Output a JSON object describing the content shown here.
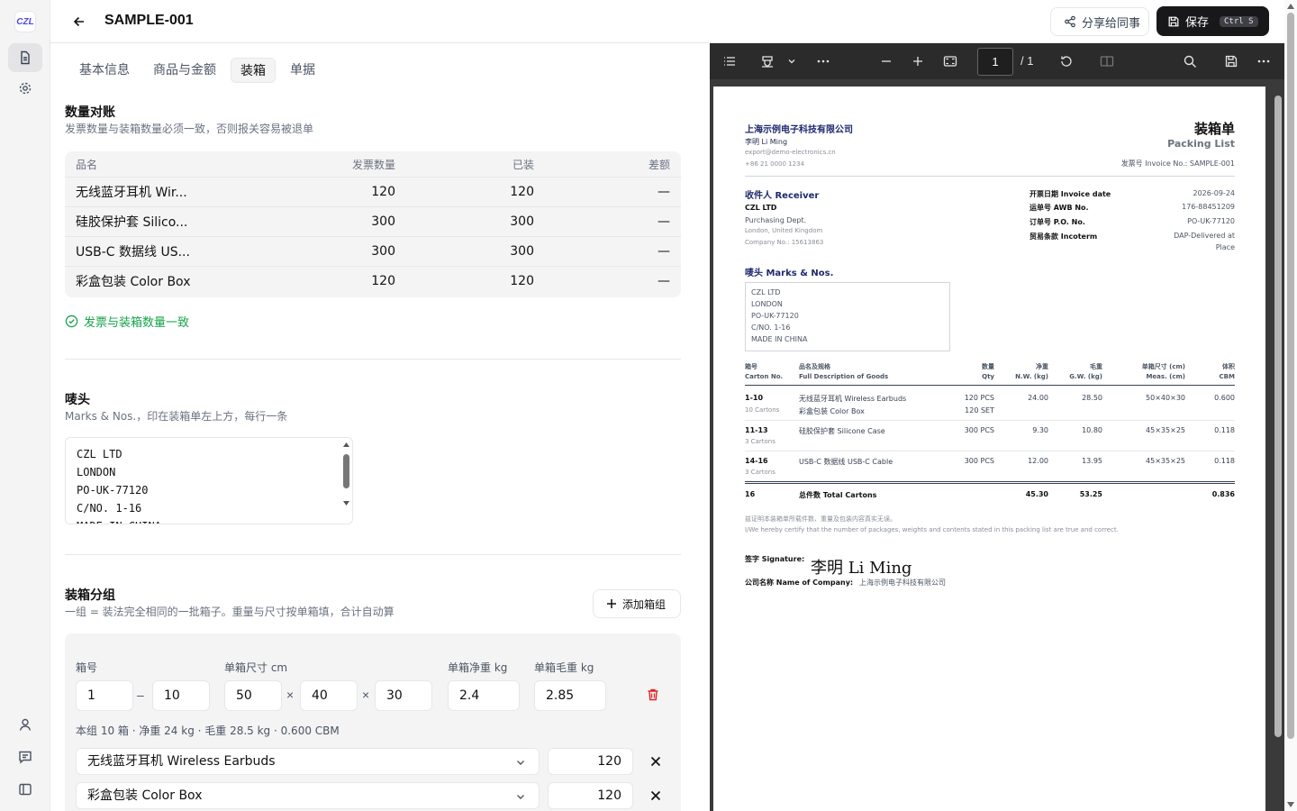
{
  "app": {
    "logo_text": "CZL"
  },
  "header": {
    "doc_title": "SAMPLE-001",
    "share_label": "分享给同事",
    "save_label": "保存",
    "save_shortcut": "Ctrl S"
  },
  "tabs": [
    {
      "label": "基本信息"
    },
    {
      "label": "商品与金额"
    },
    {
      "label": "装箱",
      "active": true
    },
    {
      "label": "单据"
    }
  ],
  "qty_check": {
    "title": "数量对账",
    "subtitle": "发票数量与装箱数量必须一致，否则报关容易被退单",
    "columns": [
      "品名",
      "发票数量",
      "已装",
      "差额"
    ],
    "rows": [
      {
        "name": "无线蓝牙耳机 Wir...",
        "invoice": "120",
        "packed": "120",
        "diff": "—"
      },
      {
        "name": "硅胶保护套 Silico...",
        "invoice": "300",
        "packed": "300",
        "diff": "—"
      },
      {
        "name": "USB-C 数据线 US...",
        "invoice": "300",
        "packed": "300",
        "diff": "—"
      },
      {
        "name": "彩盒包装 Color Box",
        "invoice": "120",
        "packed": "120",
        "diff": "—"
      }
    ],
    "status": "发票与装箱数量一致"
  },
  "marks": {
    "title": "唛头",
    "subtitle": "Marks & Nos.，印在装箱单左上方，每行一条",
    "lines": [
      "CZL LTD",
      "LONDON",
      "PO-UK-77120",
      "C/NO. 1-16",
      "MADE IN CHINA"
    ]
  },
  "packing_groups": {
    "title": "装箱分组",
    "subtitle": "一组 = 装法完全相同的一批箱子。重量与尺寸按单箱填，合计自动算",
    "add_label": "添加箱组",
    "labels": {
      "carton_no": "箱号",
      "dims": "单箱尺寸 cm",
      "net": "单箱净重 kg",
      "gross": "单箱毛重 kg"
    },
    "group": {
      "from": "1",
      "to": "10",
      "l": "50",
      "w": "40",
      "h": "30",
      "net": "2.4",
      "gross": "2.85",
      "summary": "本组 10 箱 · 净重 24 kg · 毛重 28.5 kg · 0.600 CBM",
      "items": [
        {
          "name": "无线蓝牙耳机 Wireless Earbuds",
          "qty": "120"
        },
        {
          "name": "彩盒包装 Color Box",
          "qty": "120"
        }
      ]
    },
    "dash": "–",
    "times": "×"
  },
  "pdf_toolbar": {
    "page": "1",
    "total": "/ 1"
  },
  "pdf": {
    "company": "上海示例电子科技有限公司",
    "contact": "李明 Li Ming",
    "email": "export@demo-electronics.cn",
    "phone": "+86 21 0000 1234",
    "doc_title_cn": "装箱单",
    "doc_title_en": "Packing List",
    "invoice_ref": "发票号 Invoice No.: SAMPLE-001",
    "receiver_title": "收件人 Receiver",
    "receiver_name": "CZL LTD",
    "receiver_dept": "Purchasing Dept.",
    "receiver_city": "London, United Kingdom",
    "receiver_company_no": "Company No.: 15613863",
    "meta": [
      {
        "label": "开票日期 Invoice date",
        "value": "2026-09-24"
      },
      {
        "label": "运单号 AWB No.",
        "value": "176-88451209"
      },
      {
        "label": "订单号 P.O. No.",
        "value": "PO-UK-77120"
      },
      {
        "label": "贸易条款 Incoterm",
        "value": "DAP-Delivered at",
        "value2": "Place"
      }
    ],
    "marks_title": "唛头 Marks & Nos.",
    "marks_lines": [
      "CZL LTD",
      "LONDON",
      "PO-UK-77120",
      "C/NO. 1-16",
      "MADE IN CHINA"
    ],
    "table_head": {
      "carton_cn": "箱号",
      "carton_en": "Carton No.",
      "desc_cn": "品名及规格",
      "desc_en": "Full Description of Goods",
      "qty_cn": "数量",
      "qty_en": "Qty",
      "nw_cn": "净重",
      "nw_en": "N.W. (kg)",
      "gw_cn": "毛重",
      "gw_en": "G.W. (kg)",
      "meas_cn": "单箱尺寸 (cm)",
      "meas_en": "Meas. (cm)",
      "cbm_cn": "体积",
      "cbm_en": "CBM"
    },
    "rows": [
      {
        "carton": "1-10",
        "cartons": "10 Cartons",
        "desc": "无线蓝牙耳机 Wireless Earbuds",
        "desc2": "彩盒包装 Color Box",
        "qty": "120 PCS",
        "qty2": "120 SET",
        "nw": "24.00",
        "gw": "28.50",
        "meas": "50×40×30",
        "cbm": "0.600"
      },
      {
        "carton": "11-13",
        "cartons": "3 Cartons",
        "desc": "硅胶保护套 Silicone Case",
        "qty": "300 PCS",
        "nw": "9.30",
        "gw": "10.80",
        "meas": "45×35×25",
        "cbm": "0.118"
      },
      {
        "carton": "14-16",
        "cartons": "3 Cartons",
        "desc": "USB-C 数据线 USB-C Cable",
        "qty": "300 PCS",
        "nw": "12.00",
        "gw": "13.95",
        "meas": "45×35×25",
        "cbm": "0.118"
      }
    ],
    "total": {
      "cartons": "16",
      "label": "总件数 Total Cartons",
      "nw": "45.30",
      "gw": "53.25",
      "cbm": "0.836"
    },
    "certify_cn": "兹证明本装箱单所载件数、重量及包装内容真实无误。",
    "certify_en": "I/We hereby certify that the number of packages, weights and contents stated in this packing list are true and correct.",
    "signature_label": "签字 Signature:",
    "signature": "李明 Li Ming",
    "company_label": "公司名称 Name of Company:",
    "company_value": "上海示例电子科技有限公司"
  }
}
